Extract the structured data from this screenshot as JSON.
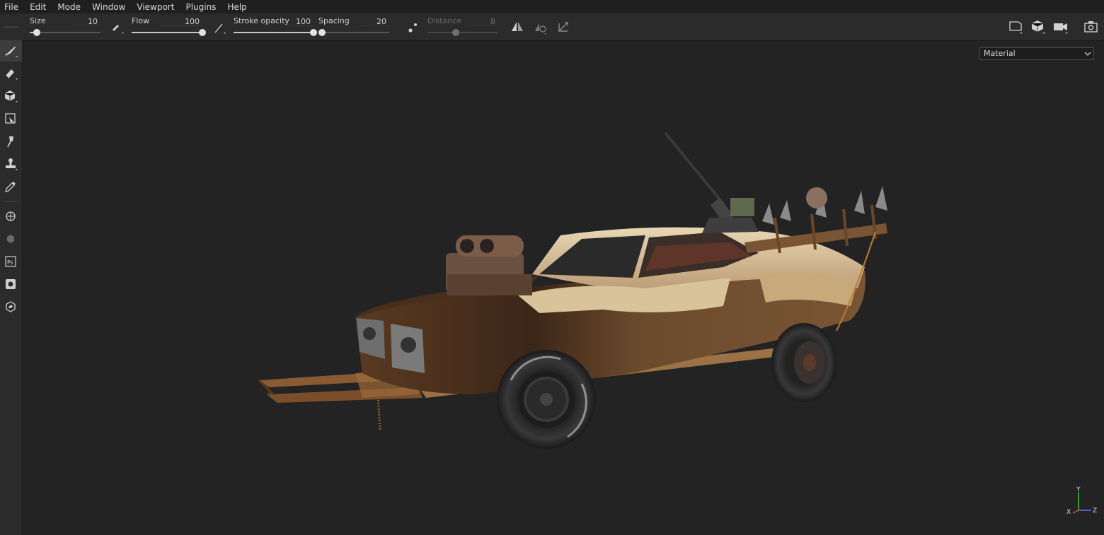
{
  "menu": [
    "File",
    "Edit",
    "Mode",
    "Window",
    "Viewport",
    "Plugins",
    "Help"
  ],
  "toolbar": {
    "size": {
      "label": "Size",
      "value": "10",
      "fraction": 0.1
    },
    "flow": {
      "label": "Flow",
      "value": "100",
      "fraction": 1.0
    },
    "stroke_opacity": {
      "label": "Stroke opacity",
      "value": "100",
      "fraction": 1.0
    },
    "spacing": {
      "label": "Spacing",
      "value": "20",
      "fraction": 0.05
    },
    "distance": {
      "label": "Distance",
      "value": "8",
      "fraction": 0.4
    }
  },
  "left_tools": [
    "paint-brush-icon",
    "eraser-icon",
    "projection-icon",
    "geometry-select-icon",
    "smudge-icon",
    "clone-stamp-icon",
    "color-picker-icon",
    "bake-icon",
    "material-ball-icon",
    "photoshop-icon",
    "viewer-icon",
    "substance-icon"
  ],
  "viewport": {
    "material_select": "Material",
    "axis": {
      "x": "X",
      "y": "Y",
      "z": "Z"
    }
  },
  "colors": {
    "accent": "#c8c8c8",
    "bg": "#232323",
    "panel": "#2b2b2b"
  }
}
